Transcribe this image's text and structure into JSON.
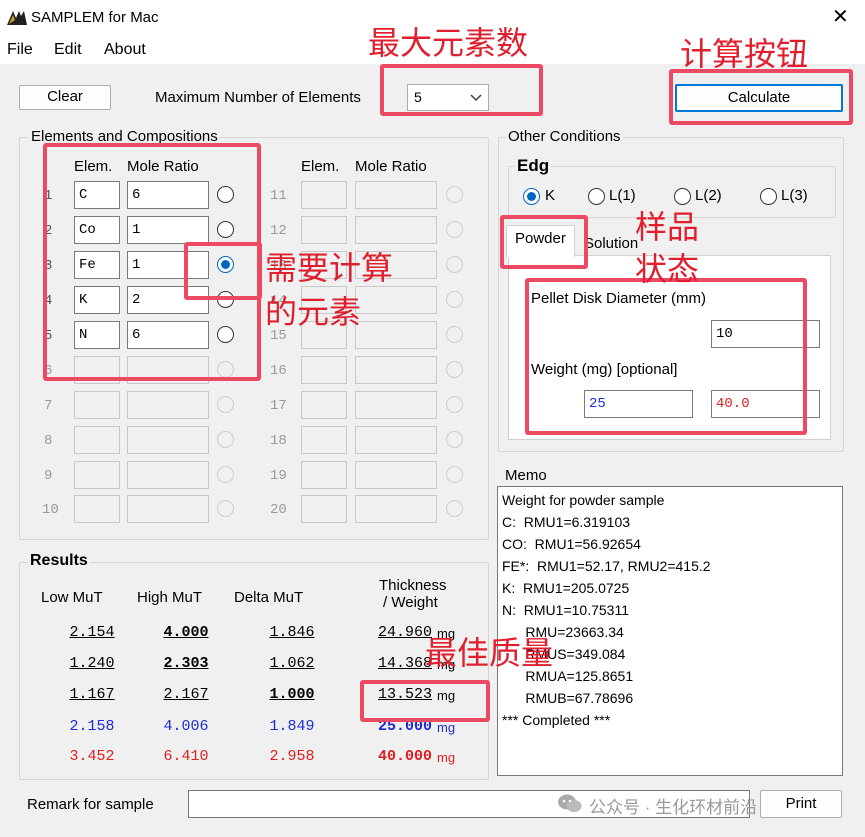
{
  "window": {
    "title": "SAMPLEM for Mac",
    "close_glyph": "✕"
  },
  "menu": [
    "File",
    "Edit",
    "About"
  ],
  "toolbar": {
    "clear_label": "Clear",
    "max_elements_label": "Maximum Number of Elements",
    "max_elements_value": "5",
    "calculate_label": "Calculate"
  },
  "elements_group": {
    "title": "Elements and Compositions",
    "col_elem": "Elem.",
    "col_ratio": "Mole Ratio",
    "rows": [
      {
        "num": "1",
        "elem": "C",
        "ratio": "6"
      },
      {
        "num": "2",
        "elem": "Co",
        "ratio": "1"
      },
      {
        "num": "3",
        "elem": "Fe",
        "ratio": "1"
      },
      {
        "num": "4",
        "elem": "K",
        "ratio": "2"
      },
      {
        "num": "5",
        "elem": "N",
        "ratio": "6"
      },
      {
        "num": "6",
        "elem": "",
        "ratio": ""
      },
      {
        "num": "7",
        "elem": "",
        "ratio": ""
      },
      {
        "num": "8",
        "elem": "",
        "ratio": ""
      },
      {
        "num": "9",
        "elem": "",
        "ratio": ""
      },
      {
        "num": "10",
        "elem": "",
        "ratio": ""
      }
    ],
    "rows_right": [
      "11",
      "12",
      "13",
      "14",
      "15",
      "16",
      "17",
      "18",
      "19",
      "20"
    ],
    "selected_row": "3"
  },
  "other_conditions": {
    "title": "Other Conditions",
    "edge_label": "Edg",
    "edges": [
      "K",
      "L(1)",
      "L(2)",
      "L(3)"
    ],
    "edge_selected": "K",
    "tabs": [
      "Powder",
      "Solution"
    ],
    "pellet_label": "Pellet Disk Diameter (mm)",
    "pellet_value": "10",
    "weight_label": "Weight (mg) [optional]",
    "weight_blue": "25",
    "weight_red": "40.0"
  },
  "results": {
    "title": "Results",
    "headers": [
      "Low MuT",
      "High MuT",
      "Delta MuT",
      "Thickness",
      "/ Weight"
    ],
    "rows": [
      {
        "low": "2.154",
        "high": "4.000",
        "delta": "1.846",
        "thick": "24.960",
        "unit": "mg"
      },
      {
        "low": "1.240",
        "high": "2.303",
        "delta": "1.062",
        "thick": "14.368",
        "unit": "mg"
      },
      {
        "low": "1.167",
        "high": "2.167",
        "delta": "1.000",
        "thick": "13.523",
        "unit": "mg"
      },
      {
        "low": "2.158",
        "high": "4.006",
        "delta": "1.849",
        "thick": "25.000",
        "unit": "mg"
      },
      {
        "low": "3.452",
        "high": "6.410",
        "delta": "2.958",
        "thick": "40.000",
        "unit": "mg"
      }
    ]
  },
  "memo": {
    "label": "Memo",
    "text": "Weight for powder sample\nC:  RMU1=6.319103\nCO:  RMU1=56.92654\nFE*:  RMU1=52.17, RMU2=415.2\nK:  RMU1=205.0725\nN:  RMU1=10.75311\n      RMU=23663.34\n      RMUS=349.084\n      RMUA=125.8651\n      RMUB=67.78696\n*** Completed ***"
  },
  "remark": {
    "label": "Remark for sample",
    "value": "",
    "print_label": "Print"
  },
  "annotations": {
    "max_elements": "最大元素数",
    "calc_button": "计算按钮",
    "sample_state_1": "样品",
    "sample_state_2": "状态",
    "target_element_1": "需要计算",
    "target_element_2": "的元素",
    "best_mass": "最佳质量"
  },
  "watermark": "公众号 · 生化环材前沿",
  "colors": {
    "annotation": "#ec4a63",
    "accent": "#0067c0",
    "blue_text": "#1e2bd8",
    "red_text": "#e01e1e"
  }
}
